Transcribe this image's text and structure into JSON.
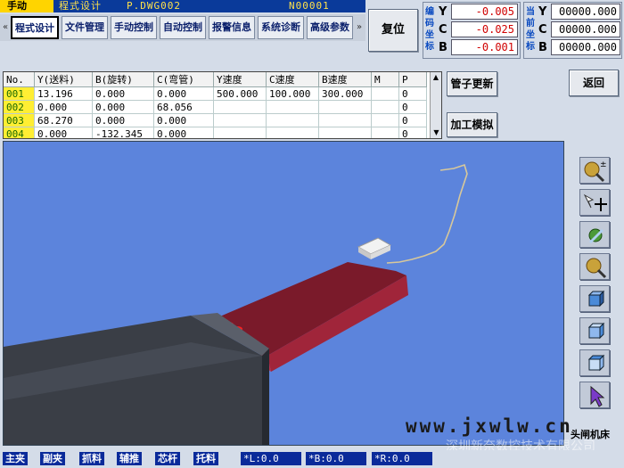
{
  "header": {
    "mode": "手动",
    "title": "程式设计",
    "program": "P.DWG002",
    "block": "N00001"
  },
  "tabs": [
    "程式设计",
    "文件管理",
    "手动控制",
    "自动控制",
    "报警信息",
    "系统诊断",
    "高级参数"
  ],
  "scroll_left": "«",
  "scroll_right": "»",
  "reset_label": "复位",
  "coords": {
    "program_label": [
      "编",
      "码",
      "坐",
      "标"
    ],
    "program": [
      {
        "axis": "Y",
        "value": "-0.005"
      },
      {
        "axis": "C",
        "value": "-0.025"
      },
      {
        "axis": "B",
        "value": "-0.001"
      }
    ],
    "current_label": [
      "当",
      "前",
      "坐",
      "标"
    ],
    "current": [
      {
        "axis": "Y",
        "value": "00000.000"
      },
      {
        "axis": "C",
        "value": "00000.000"
      },
      {
        "axis": "B",
        "value": "00000.000"
      }
    ]
  },
  "table": {
    "headers": [
      "No.",
      "Y(送料)",
      "B(旋转)",
      "C(弯管)",
      "Y速度",
      "C速度",
      "B速度",
      "M",
      "P"
    ],
    "rows": [
      [
        "001",
        "13.196",
        "0.000",
        "0.000",
        "500.000",
        "100.000",
        "300.000",
        "",
        "0"
      ],
      [
        "002",
        "0.000",
        "0.000",
        "68.056",
        "",
        "",
        "",
        "",
        "0"
      ],
      [
        "003",
        "68.270",
        "0.000",
        "0.000",
        "",
        "",
        "",
        "",
        "0"
      ],
      [
        "004",
        "0.000",
        "-132.345",
        "0.000",
        "",
        "",
        "",
        "",
        "0"
      ]
    ]
  },
  "buttons": {
    "update_tube": "管子更新",
    "simulate": "加工模拟",
    "back": "返回"
  },
  "status": {
    "items": [
      "主夹",
      "副夹",
      "抓料",
      "辅推",
      "芯杆",
      "托料"
    ],
    "L": "*L:0.0",
    "B": "*B:0.0",
    "R": "*R:0.0"
  },
  "watermark": {
    "site": "www.jxwlw.cn",
    "company": "深圳新奈数控技术有限公司",
    "tag": "头闸机床"
  },
  "colors": {
    "accent_blue": "#0a3a9a",
    "mode_yellow": "#ffd400",
    "viewport_bg": "#5c84dc",
    "machine_dark": "#2a3040",
    "tube_red": "#7a1a2a"
  },
  "toolbar_icons": [
    "zoom-icon",
    "move-icon",
    "rotate-icon",
    "magnify-icon",
    "cube-front-icon",
    "cube-side-icon",
    "cube-top-icon",
    "pointer-icon"
  ]
}
